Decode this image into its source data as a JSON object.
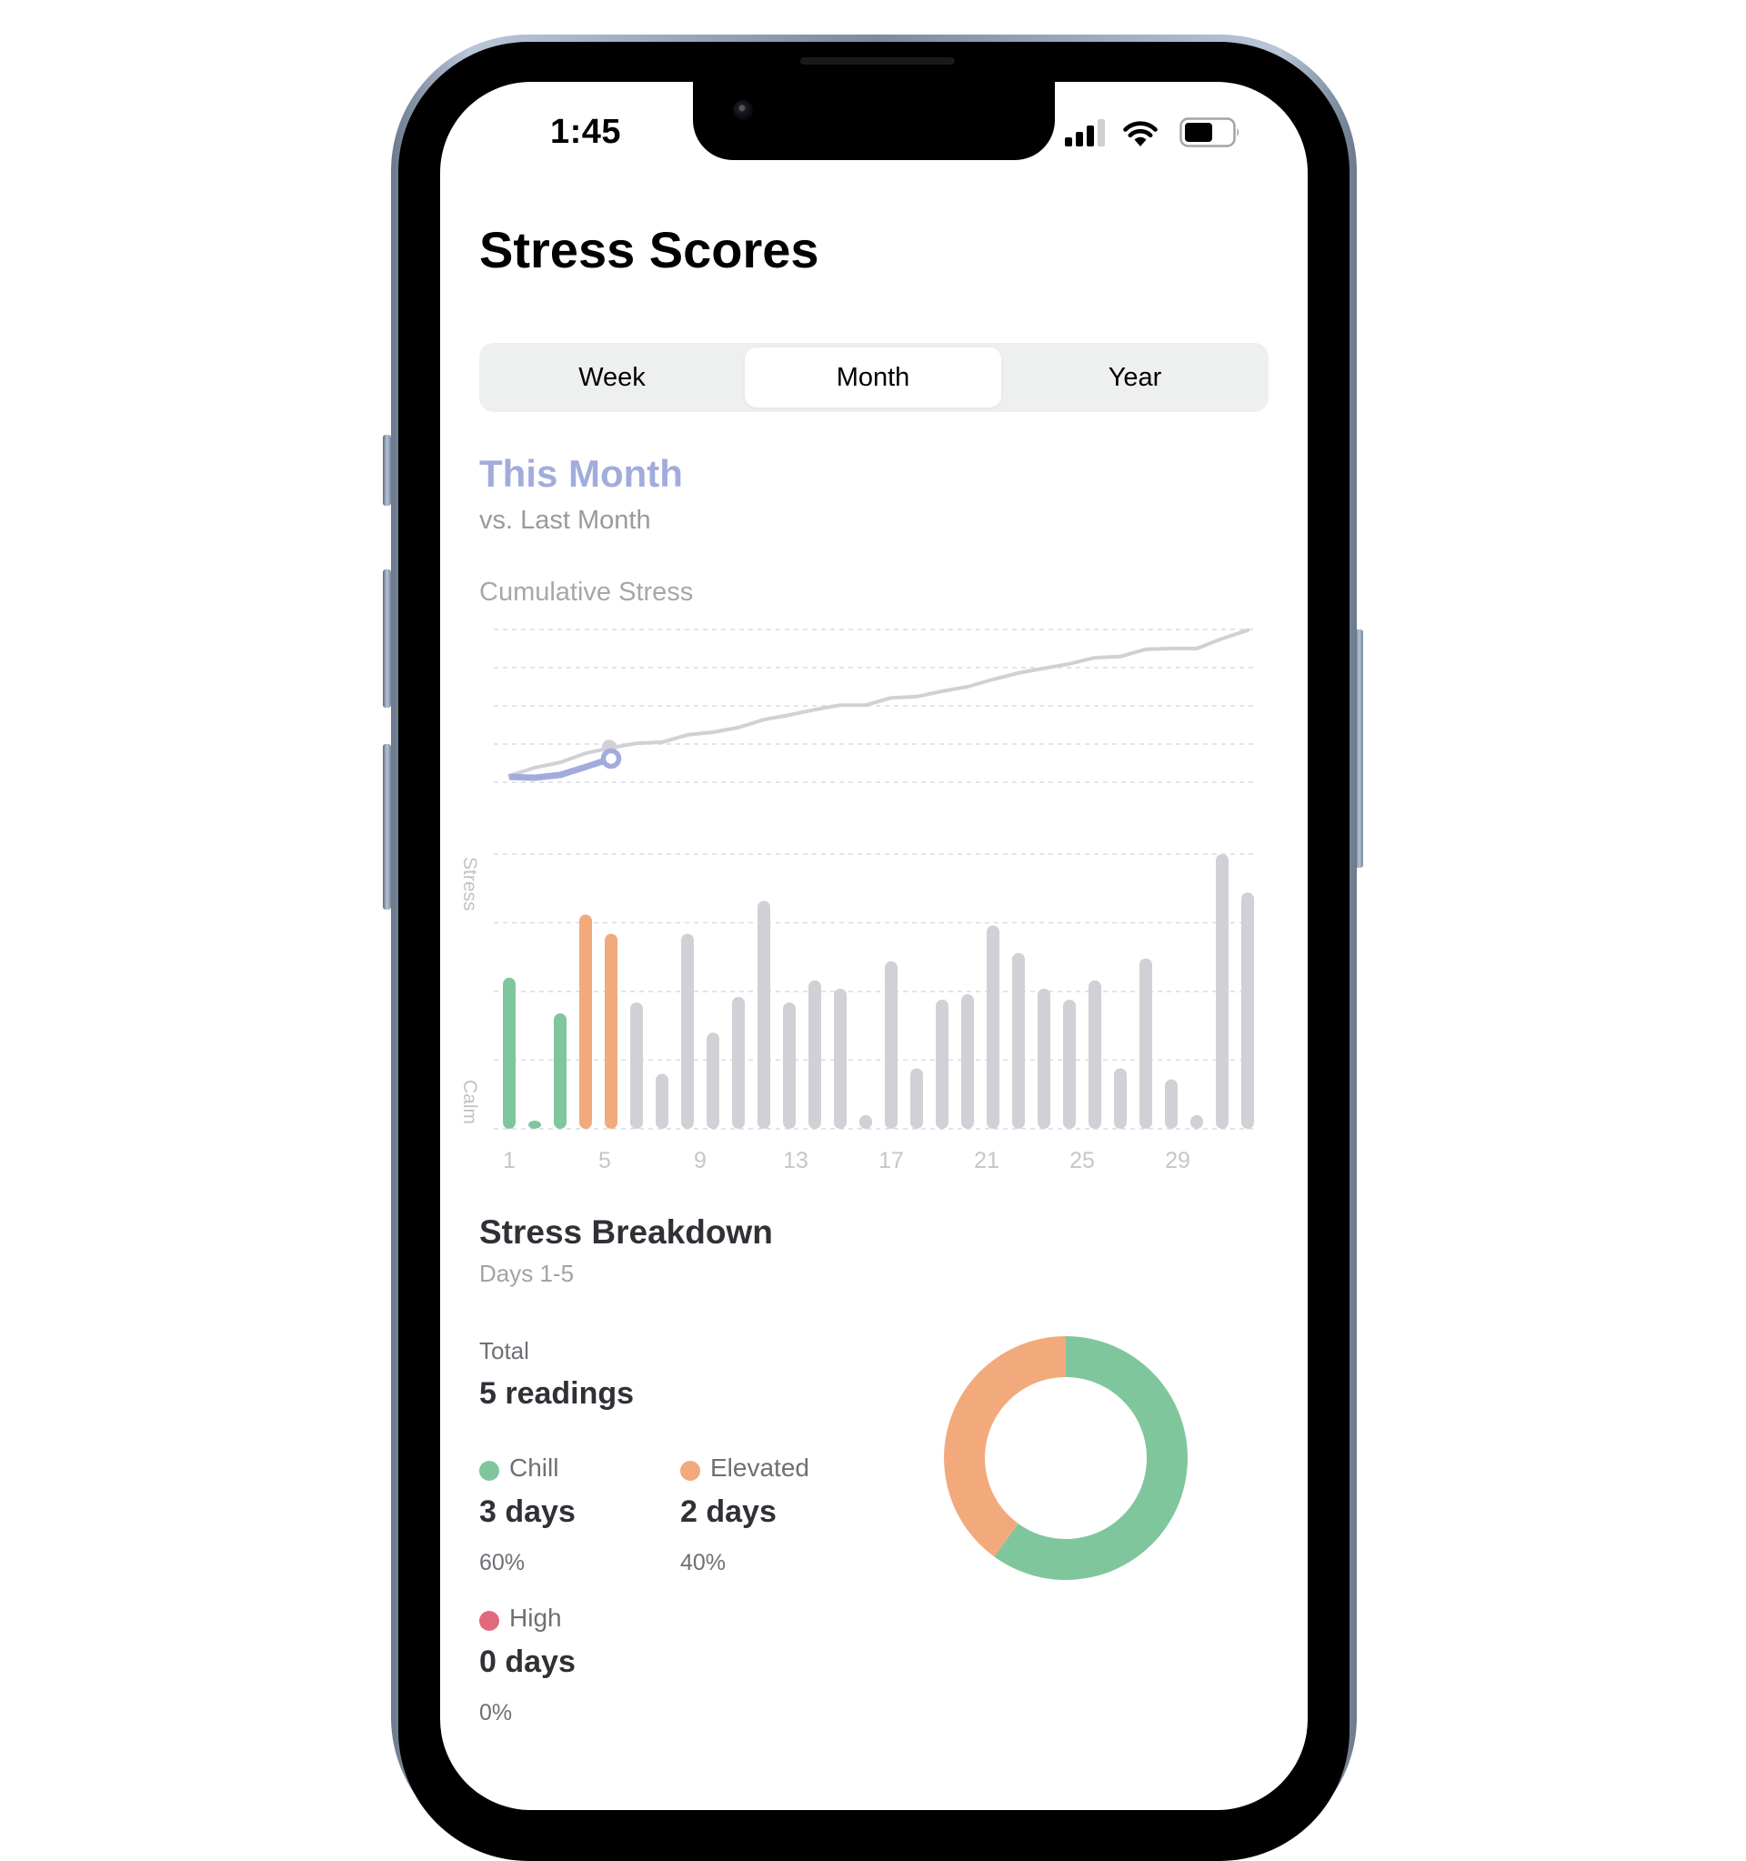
{
  "status_bar": {
    "time": "1:45",
    "signal_bars_active": 3,
    "signal_bars_total": 4,
    "battery_level": 0.6,
    "icons": [
      "cellular-signal-icon",
      "wifi-icon",
      "battery-icon"
    ]
  },
  "page": {
    "title": "Stress Scores"
  },
  "period_selector": {
    "options": [
      {
        "label": "Week",
        "selected": false
      },
      {
        "label": "Month",
        "selected": true
      },
      {
        "label": "Year",
        "selected": false
      }
    ]
  },
  "summary": {
    "heading": "This Month",
    "comparison": "vs. Last Month",
    "chart_title": "Cumulative Stress"
  },
  "colors": {
    "this_month": "#a2acdc",
    "last_month": "#d0d0d6",
    "chill": "#80c69c",
    "elevated": "#f2aa7d",
    "high": "#e2697c",
    "future": "#d0d0d6",
    "grid": "#d8dbe3"
  },
  "breakdown": {
    "title": "Stress Breakdown",
    "range": "Days 1-5",
    "total_label": "Total",
    "total_value": "5 readings",
    "categories": [
      {
        "name": "Chill",
        "days": "3 days",
        "percent": "60%",
        "color": "#80c69c",
        "fraction": 0.6
      },
      {
        "name": "Elevated",
        "days": "2 days",
        "percent": "40%",
        "color": "#f2aa7d",
        "fraction": 0.4
      },
      {
        "name": "High",
        "days": "0 days",
        "percent": "0%",
        "color": "#e2697c",
        "fraction": 0.0
      }
    ]
  },
  "chart_data": [
    {
      "type": "line",
      "title": "Cumulative Stress",
      "xlabel": "",
      "ylabel": "",
      "x": [
        1,
        2,
        3,
        4,
        5,
        6,
        7,
        8,
        9,
        10,
        11,
        12,
        13,
        14,
        15,
        16,
        17,
        18,
        19,
        20,
        21,
        22,
        23,
        24,
        25,
        26,
        27,
        28,
        29,
        30
      ],
      "ylim": [
        0,
        4
      ],
      "grid": true,
      "gridlines": 5,
      "series": [
        {
          "name": "Last Month",
          "color": "#d0d0d6",
          "values": [
            0.17,
            0.38,
            0.52,
            0.76,
            0.9,
            1.02,
            1.05,
            1.24,
            1.31,
            1.43,
            1.64,
            1.76,
            1.9,
            2.02,
            2.02,
            2.21,
            2.24,
            2.38,
            2.5,
            2.69,
            2.86,
            2.98,
            3.1,
            3.26,
            3.29,
            3.48,
            3.5,
            3.5,
            3.76,
            3.98
          ]
        },
        {
          "name": "This Month",
          "color": "#a2acdc",
          "values": [
            0.14,
            0.12,
            0.19,
            0.4,
            0.62
          ],
          "current_day": 5
        }
      ]
    },
    {
      "type": "bar",
      "title": "",
      "xlabel": "",
      "ylabel": "Calm → Stress",
      "y_axis_labels": {
        "low": "Calm",
        "high": "Stress"
      },
      "categories": [
        1,
        2,
        3,
        4,
        5,
        6,
        7,
        8,
        9,
        10,
        11,
        12,
        13,
        14,
        15,
        16,
        17,
        18,
        19,
        20,
        21,
        22,
        23,
        24,
        25,
        26,
        27,
        28,
        29,
        30
      ],
      "tick_labels": [
        "1",
        "5",
        "9",
        "13",
        "17",
        "21",
        "25",
        "29"
      ],
      "tick_days": [
        1,
        5,
        9,
        13,
        17,
        21,
        25,
        29
      ],
      "ylim": [
        0,
        100
      ],
      "grid": true,
      "gridlines": 5,
      "values": [
        55,
        2,
        42,
        78,
        71,
        46,
        20,
        71,
        35,
        48,
        83,
        46,
        54,
        51,
        5,
        61,
        22,
        47,
        49,
        74,
        64,
        51,
        47,
        54,
        22,
        62,
        18,
        5,
        100,
        86
      ],
      "bar_status": [
        "chill",
        "chill",
        "chill",
        "elevated",
        "elevated",
        "future",
        "future",
        "future",
        "future",
        "future",
        "future",
        "future",
        "future",
        "future",
        "future",
        "future",
        "future",
        "future",
        "future",
        "future",
        "future",
        "future",
        "future",
        "future",
        "future",
        "future",
        "future",
        "future",
        "future",
        "future"
      ]
    },
    {
      "type": "pie",
      "title": "Stress Breakdown",
      "donut": true,
      "categories": [
        "Chill",
        "Elevated",
        "High"
      ],
      "values": [
        3,
        2,
        0
      ],
      "colors": [
        "#80c69c",
        "#f2aa7d",
        "#e2697c"
      ]
    }
  ]
}
